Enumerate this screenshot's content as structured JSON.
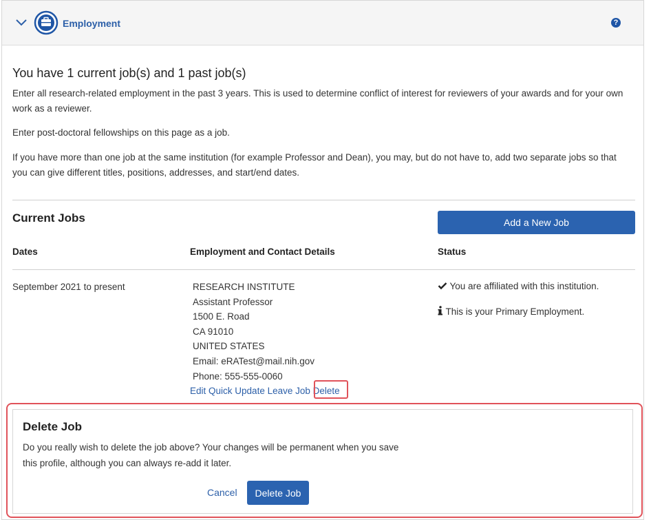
{
  "header": {
    "title": "Employment",
    "help": "?"
  },
  "summary": {
    "title": "You have 1 current job(s) and 1 past job(s)",
    "para1": "Enter all research-related employment in the past 3 years. This is used to determine conflict of interest for reviewers of your awards and for your own work as a reviewer.",
    "para2": "Enter post-doctoral fellowships on this page as a job.",
    "para3": "If you have more than one job at the same institution (for example Professor and Dean), you may, but do not have to, add two separate jobs so that you can give different titles, positions, addresses, and start/end dates."
  },
  "current_jobs": {
    "title": "Current Jobs",
    "add_button": "Add a New Job",
    "columns": [
      "Dates",
      "Employment and Contact Details",
      "Status"
    ],
    "job": {
      "dates": "September 2021 to present",
      "details": [
        "RESEARCH INSTITUTE",
        "Assistant Professor",
        "1500 E. Road",
        "CA 91010",
        "UNITED STATES",
        "Email: eRATest@mail.nih.gov",
        "Phone: 555-555-0060"
      ],
      "actions": [
        "Edit",
        "Quick Update",
        "Leave Job",
        "Delete"
      ],
      "status": [
        {
          "icon": "check-icon",
          "text": "You are affiliated with this institution."
        },
        {
          "icon": "info-icon",
          "text": "This is your Primary Employment."
        }
      ]
    }
  },
  "delete_dialog": {
    "title": "Delete Job",
    "message": "Do you really wish to delete the job above? Your changes will be permanent when you save this profile, although you can always re-add it later.",
    "cancel_label": "Cancel",
    "confirm_label": "Delete Job"
  },
  "colors": {
    "primary": "#2b63b0",
    "link": "#2c5fa8",
    "highlight": "#e05259",
    "header_bg": "#f5f5f5"
  }
}
